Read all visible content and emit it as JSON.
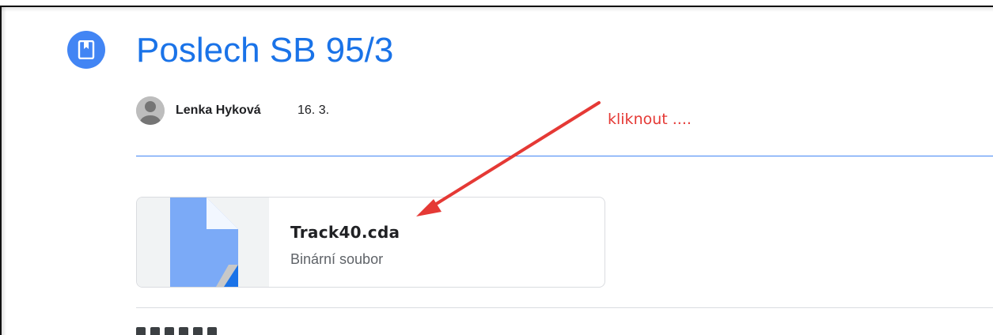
{
  "page": {
    "title": "Poslech SB 95/3",
    "title_icon": "bookmark-icon",
    "accent_color": "#1a73e8"
  },
  "author": {
    "name": "Lenka Hyková",
    "date": "16. 3.",
    "avatar_icon": "person-icon"
  },
  "attachment": {
    "name": "Track40.cda",
    "type": "Binární soubor",
    "icon": "file-icon",
    "icon_color": "#7baaf7"
  },
  "annotation": {
    "text": "kliknout ....",
    "color": "#e53935"
  }
}
